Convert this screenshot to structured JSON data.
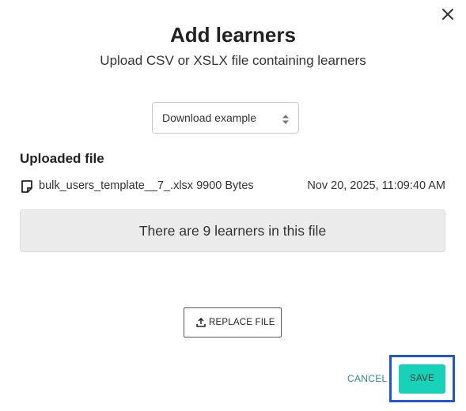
{
  "dialog": {
    "title": "Add learners",
    "subtitle": "Upload CSV or XSLX file containing learners",
    "close_icon": "close-icon"
  },
  "download_select": {
    "selected": "Download example",
    "icon": "sort-arrows-icon"
  },
  "uploaded": {
    "heading": "Uploaded file",
    "file_icon": "file-icon",
    "file_name": "bulk_users_template__7_.xlsx 9900 Bytes",
    "file_date": "Nov 20, 2025, 11:09:40 AM",
    "summary": "There are 9 learners in this file"
  },
  "actions": {
    "replace_label": "REPLACE FILE",
    "replace_icon": "upload-icon",
    "cancel_label": "CANCEL",
    "save_label": "SAVE"
  },
  "colors": {
    "accent": "#17d1b8",
    "cancel_text": "#2a8a93",
    "highlight": "#1f55d6"
  }
}
